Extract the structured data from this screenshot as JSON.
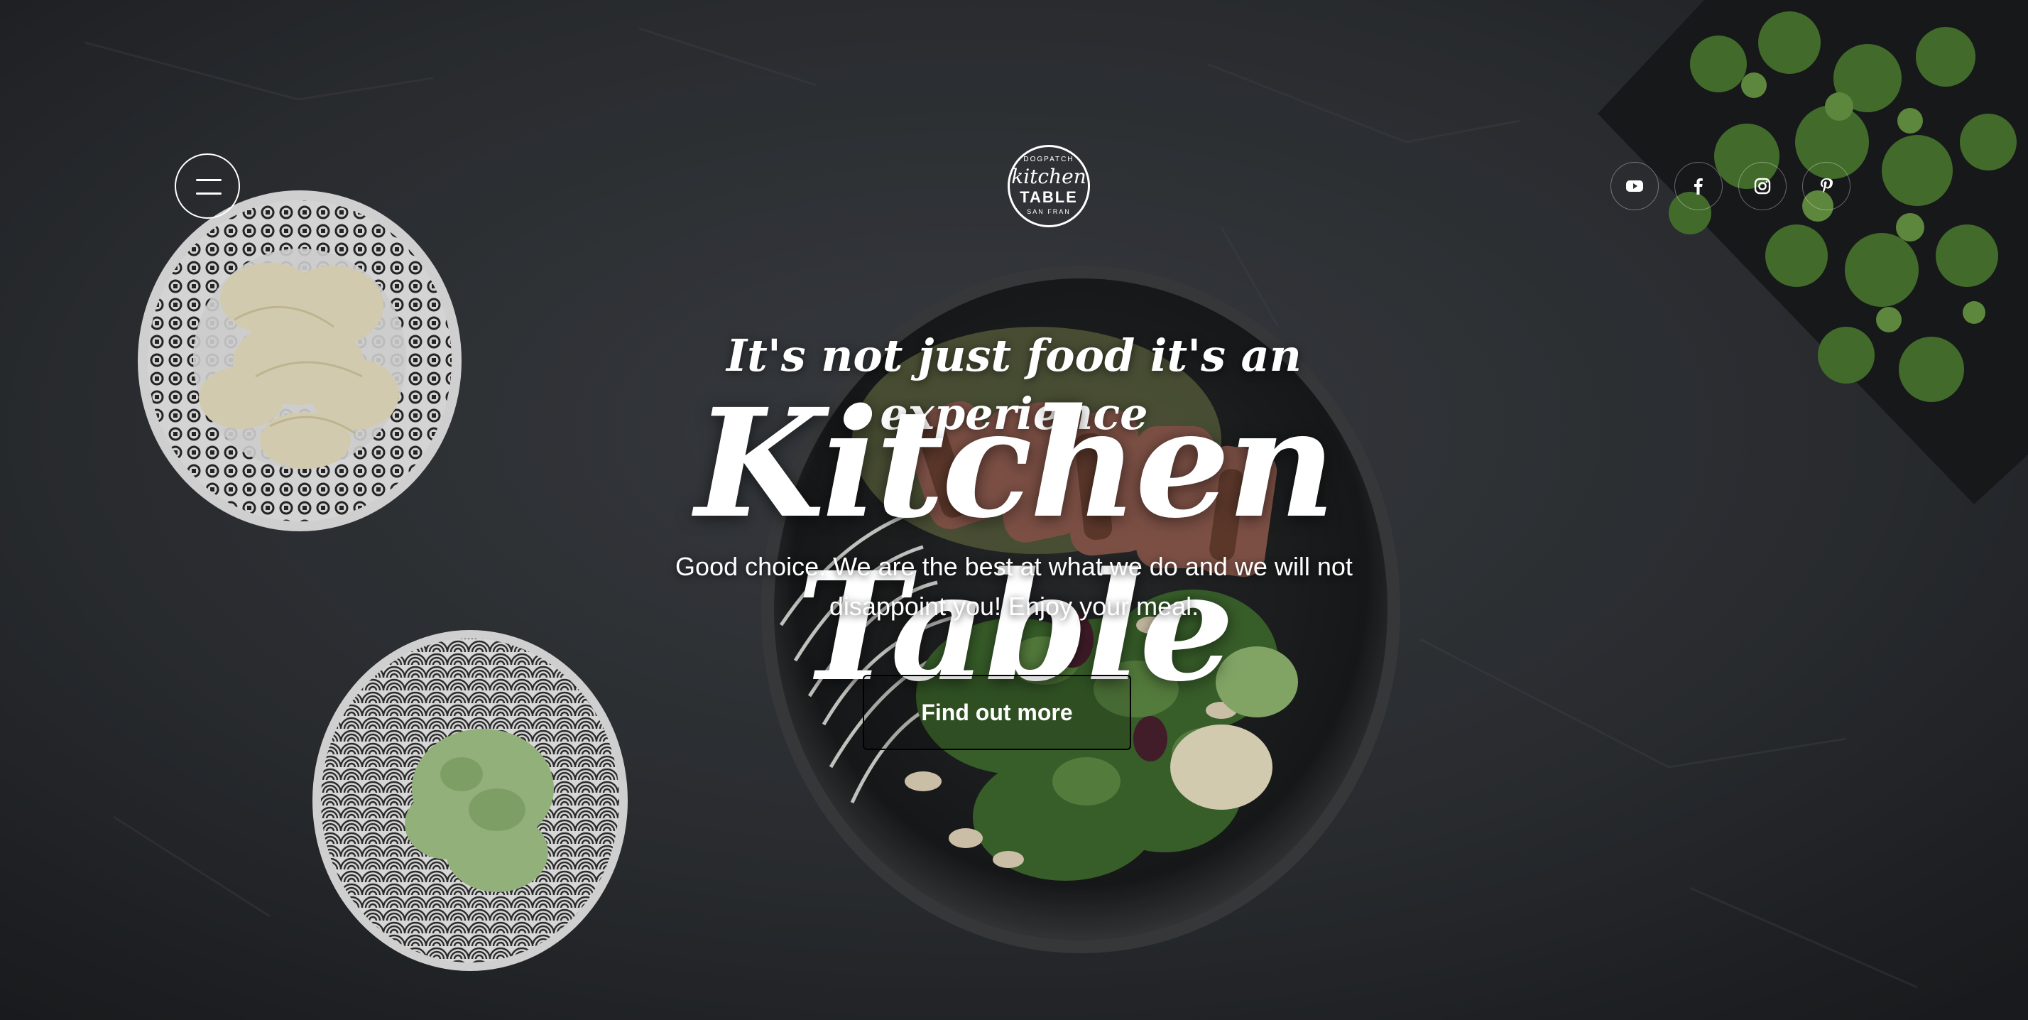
{
  "colors": {
    "background": "#2c2f33",
    "text": "#ffffff",
    "button_border": "#000000"
  },
  "nav": {
    "menu_icon": "hamburger-menu-icon"
  },
  "logo": {
    "arc_top": "DOGPATCH",
    "script": "kitchen",
    "caps": "TABLE",
    "arc_bottom": "SAN FRAN"
  },
  "socials": [
    {
      "icon": "youtube-icon"
    },
    {
      "icon": "facebook-icon"
    },
    {
      "icon": "instagram-icon"
    },
    {
      "icon": "pinterest-icon"
    }
  ],
  "hero": {
    "tagline": "It's not just food it's an experience",
    "title": "Kitchen Table",
    "description": "Good choice. We are the best at what we do and we will not disappoint you! Enjoy your meal.",
    "cta_label": "Find out more"
  }
}
